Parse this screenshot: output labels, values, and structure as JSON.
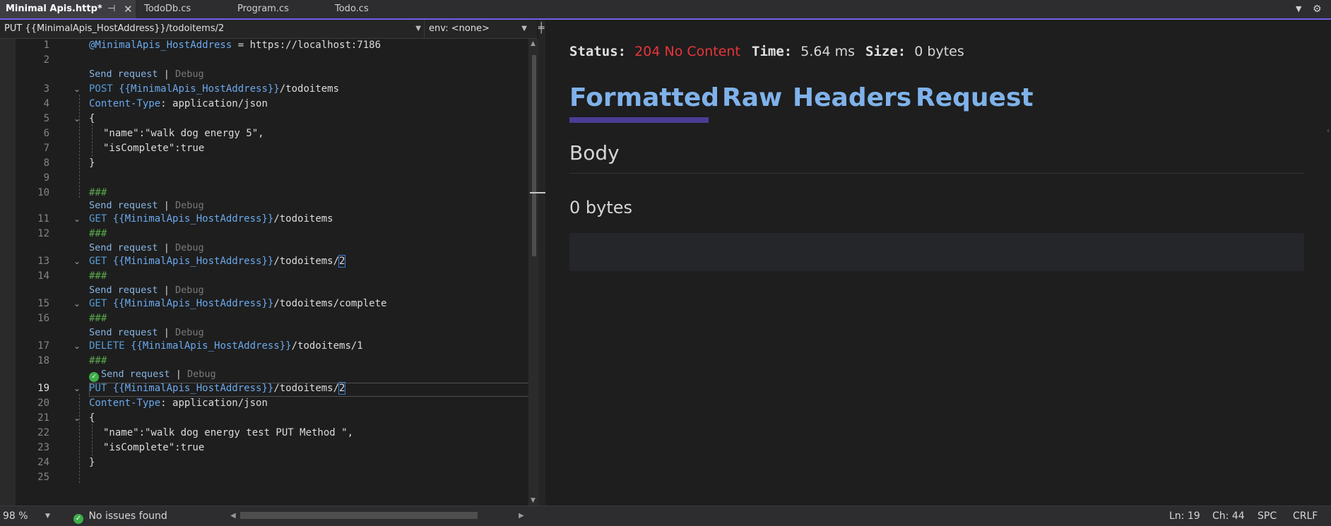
{
  "tabs": [
    {
      "label": "Minimal Apis.http*",
      "active": true
    },
    {
      "label": "TodoDb.cs",
      "active": false
    },
    {
      "label": "Program.cs",
      "active": false
    },
    {
      "label": "Todo.cs",
      "active": false
    }
  ],
  "nav": {
    "request_select": "PUT {{MinimalApis_HostAddress}}/todoitems/2",
    "env_select": "env: <none>"
  },
  "lens": {
    "send": "Send request",
    "sep": "|",
    "debug": "Debug"
  },
  "editor": {
    "line1_var": "@MinimalApis_HostAddress",
    "line1_rest": " = https://localhost:7186",
    "post_method": "POST",
    "host_var": "{{MinimalApis_HostAddress}}",
    "path_todoitems": "/todoitems",
    "path_todoitems_slash": "/todoitems/",
    "path_complete": "/todoitems/complete",
    "path_todo1": "/todoitems/1",
    "id2": "2",
    "content_type_key": "Content-Type",
    "content_type_val": ": application/json",
    "open_brace": "{",
    "close_brace": "}",
    "name1": "\"name\":\"walk dog energy 5\",",
    "iscomplete": "\"isComplete\":true",
    "sep": "###",
    "get": "GET",
    "delete": "DELETE",
    "put": "PUT",
    "name2": "\"name\":\"walk dog energy test PUT Method \","
  },
  "line_numbers": [
    "1",
    "2",
    "3",
    "4",
    "5",
    "6",
    "7",
    "8",
    "9",
    "10",
    "11",
    "12",
    "13",
    "14",
    "15",
    "16",
    "17",
    "18",
    "19",
    "20",
    "21",
    "22",
    "23",
    "24",
    "25"
  ],
  "current_line": "19",
  "response": {
    "status_label": "Status:",
    "status_value": "204 No Content",
    "time_label": "Time:",
    "time_value": "5.64 ms",
    "size_label": "Size:",
    "size_value": "0 bytes",
    "tabs": [
      "Formatted",
      "Raw",
      "Headers",
      "Request"
    ],
    "body_heading": "Body",
    "body_size": "0 bytes"
  },
  "statusbar": {
    "zoom": "98 %",
    "issues": "No issues found",
    "ln": "Ln: 19",
    "ch": "Ch: 44",
    "spc": "SPC",
    "crlf": "CRLF"
  },
  "colors": {
    "accent": "#7160e8",
    "status_error": "#e8353a",
    "link": "#7fb2ea",
    "ok": "#3fae49"
  }
}
